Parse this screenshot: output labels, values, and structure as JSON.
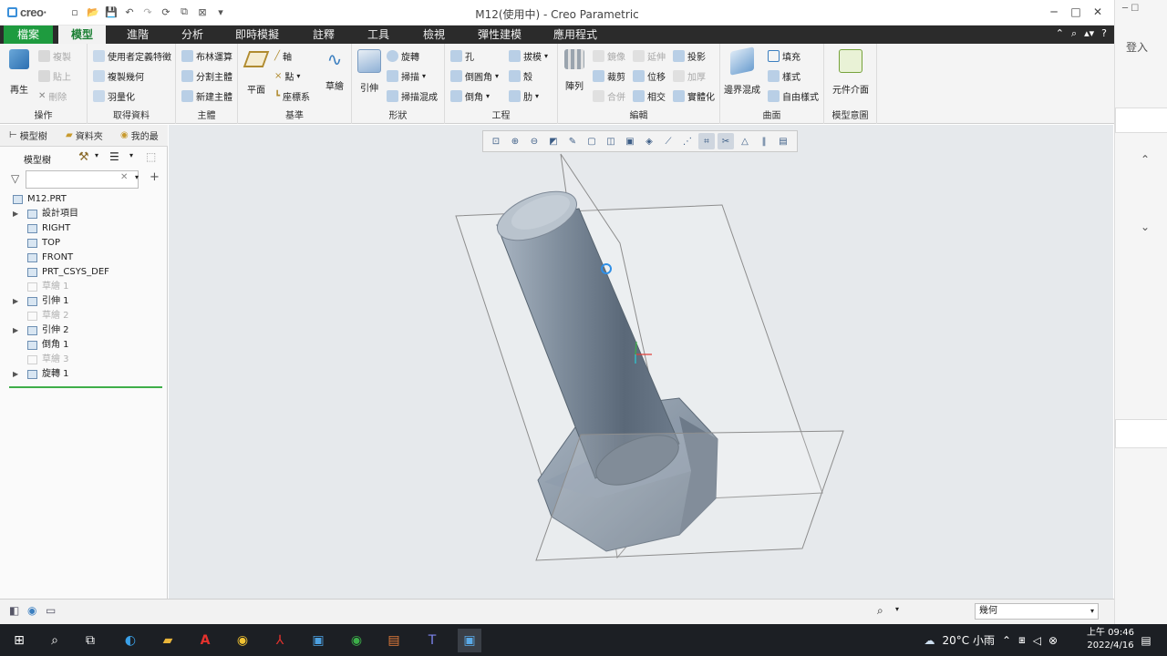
{
  "app": {
    "brand": "creo",
    "window_title": "M12(使用中) - Creo Parametric"
  },
  "menu_tabs": [
    "檔案",
    "模型",
    "進階",
    "分析",
    "即時模擬",
    "註釋",
    "工具",
    "檢視",
    "彈性建模",
    "應用程式"
  ],
  "ribbon": {
    "operations": {
      "label": "操作",
      "regen": "再生",
      "copy": "複製",
      "paste": "貼上",
      "delete": "刪除"
    },
    "get_data": {
      "label": "取得資料",
      "udf": "使用者定義特徵",
      "copy_geom": "複製幾何",
      "shrinkwrap": "羽量化"
    },
    "body": {
      "label": "主體",
      "boolean": "布林運算",
      "split": "分割主體",
      "new_body": "新建主體"
    },
    "datum": {
      "label": "基準",
      "plane": "平面",
      "axis": "軸",
      "point": "點",
      "csys": "座標系",
      "sketch": "草繪"
    },
    "shapes": {
      "label": "形狀",
      "extrude": "引伸",
      "revolve": "旋轉",
      "sweep": "掃描",
      "swept_blend": "掃描混成"
    },
    "engineering": {
      "label": "工程",
      "hole": "孔",
      "round": "倒圓角",
      "chamfer": "倒角",
      "draft": "拔模",
      "shell": "殼",
      "rib": "肋"
    },
    "editing": {
      "label": "編輯",
      "pattern": "陣列",
      "mirror": "鏡像",
      "extend": "延伸",
      "project": "投影",
      "trim": "裁剪",
      "offset": "位移",
      "thicken": "加厚",
      "merge": "合併",
      "intersect": "相交",
      "solidify": "實體化"
    },
    "surfaces": {
      "label": "曲面",
      "boundary_blend": "邊界混成",
      "fill": "填充",
      "style": "樣式",
      "freestyle": "自由樣式"
    },
    "model_intent": {
      "label": "模型意圖",
      "component_interface": "元件介面"
    }
  },
  "left_panel": {
    "tabs": [
      "模型樹",
      "資料夾",
      "我的最"
    ],
    "tree_label": "模型樹",
    "filter_placeholder": "",
    "tree": [
      {
        "name": "M12.PRT",
        "expand": false,
        "dim": false,
        "level": 0
      },
      {
        "name": "設計項目",
        "expand": true,
        "dim": false,
        "level": 1
      },
      {
        "name": "RIGHT",
        "expand": false,
        "dim": false,
        "level": 1
      },
      {
        "name": "TOP",
        "expand": false,
        "dim": false,
        "level": 1
      },
      {
        "name": "FRONT",
        "expand": false,
        "dim": false,
        "level": 1
      },
      {
        "name": "PRT_CSYS_DEF",
        "expand": false,
        "dim": false,
        "level": 1
      },
      {
        "name": "草繪 1",
        "expand": false,
        "dim": true,
        "level": 1
      },
      {
        "name": "引伸 1",
        "expand": true,
        "dim": false,
        "level": 1
      },
      {
        "name": "草繪 2",
        "expand": false,
        "dim": true,
        "level": 1
      },
      {
        "name": "引伸 2",
        "expand": true,
        "dim": false,
        "level": 1
      },
      {
        "name": "倒角 1",
        "expand": false,
        "dim": false,
        "level": 1
      },
      {
        "name": "草繪 3",
        "expand": false,
        "dim": true,
        "level": 1
      },
      {
        "name": "旋轉 1",
        "expand": true,
        "dim": false,
        "level": 1
      }
    ]
  },
  "statusbar": {
    "filter_value": "幾何"
  },
  "side_window": {
    "login": "登入"
  },
  "taskbar": {
    "weather": "20°C 小雨",
    "time": "上午 09:46",
    "date": "2022/4/16"
  },
  "colors": {
    "accent_green": "#1e9b3f",
    "tab_dark": "#2b2b2b",
    "viewport_bg": "#e6e9ec",
    "model_steel": "#8d9aa8"
  }
}
